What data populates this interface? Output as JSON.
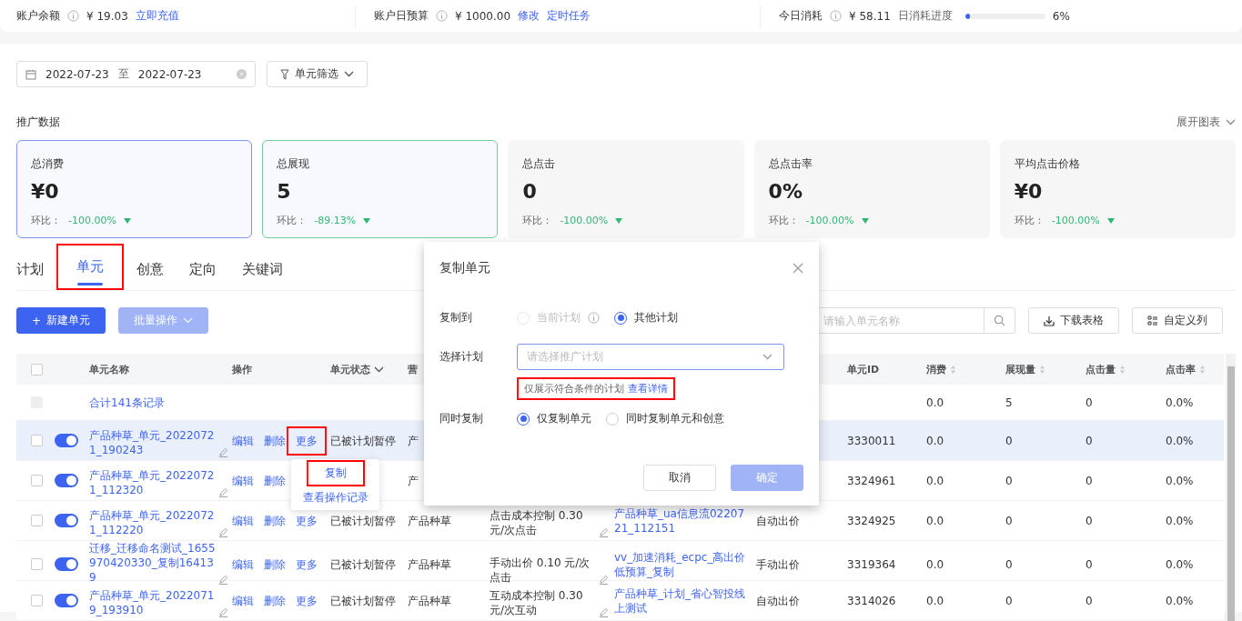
{
  "account_bar": {
    "items": [
      {
        "kind": "links",
        "label": "账户余额",
        "value": "¥ 19.03",
        "links": [
          "立即充值"
        ]
      },
      {
        "kind": "links",
        "label": "账户日预算",
        "value": "¥ 1000.00",
        "links": [
          "修改",
          "定时任务"
        ]
      },
      {
        "kind": "progress",
        "label": "今日消耗",
        "value": "¥ 58.11",
        "progress_label": "日消耗进度",
        "level": 0.06,
        "reading": "6%"
      }
    ]
  },
  "filters": {
    "date_from": "2022-07-23",
    "separator": "至",
    "date_to": "2022-07-23",
    "unit_filter": "单元筛选"
  },
  "stats": {
    "title": "推广数据",
    "expand": "展开图表",
    "cards": [
      {
        "label": "总消费",
        "value": "¥0",
        "change_label": "环比：",
        "change": "-100.00%",
        "selected": true,
        "color": "#7f95f3"
      },
      {
        "label": "总展现",
        "value": "5",
        "change_label": "环比：",
        "change": "-89.13%",
        "selected": true,
        "color": "#6fcf9f"
      },
      {
        "label": "总点击",
        "value": "0",
        "change_label": "环比：",
        "change": "-100.00%",
        "selected": false
      },
      {
        "label": "总点击率",
        "value": "0%",
        "change_label": "环比：",
        "change": "-100.00%",
        "selected": false
      },
      {
        "label": "平均点击价格",
        "value": "¥0",
        "change_label": "环比：",
        "change": "-100.00%",
        "selected": false
      }
    ]
  },
  "tabs": [
    {
      "label": "计划",
      "selected": false,
      "annotated": false
    },
    {
      "label": "单元",
      "selected": true,
      "annotated": true
    },
    {
      "label": "创意",
      "selected": false,
      "annotated": false
    },
    {
      "label": "定向",
      "selected": false,
      "annotated": false
    },
    {
      "label": "关键词",
      "selected": false,
      "annotated": false
    }
  ],
  "toolbar": {
    "new_icon": "+",
    "new_button": "新建单元",
    "batch_button": "批量操作",
    "batch_disabled": true,
    "search_placeholder": "请输入单元名称",
    "download_button": "下载表格",
    "columns_button": "自定义列"
  },
  "table": {
    "select_all_checked": false,
    "columns": [
      {
        "label": "单元名称",
        "sortable": false,
        "filter": false
      },
      {
        "label": "操作",
        "sortable": false,
        "filter": false
      },
      {
        "label": "单元状态",
        "sortable": false,
        "filter": true
      },
      {
        "label": "营",
        "sortable": false,
        "filter": false
      },
      {
        "label": "单元ID",
        "sortable": false,
        "filter": false
      },
      {
        "label": "消费",
        "sortable": true,
        "filter": false
      },
      {
        "label": "展现量",
        "sortable": true,
        "filter": false
      },
      {
        "label": "点击量",
        "sortable": true,
        "filter": false
      },
      {
        "label": "点击率",
        "sortable": true,
        "filter": false
      }
    ],
    "total": {
      "checkbox_disabled": true,
      "label": "合计141条记录",
      "cost": "0.0",
      "impressions": "5",
      "clicks": "0",
      "ctr": "0.0%"
    },
    "rows": [
      {
        "checked": false,
        "enabled": true,
        "hovered": true,
        "name": "产品种草_单元_20220721_190243",
        "actions": [
          {
            "label": "编辑",
            "annotated": false
          },
          {
            "label": "删除",
            "annotated": false
          },
          {
            "label": "更多",
            "annotated": true
          }
        ],
        "status": "已被计划暂停",
        "marketing": "产",
        "id": "3330011",
        "cost": "0.0",
        "impressions": "0",
        "clicks": "0",
        "ctr": "0.0%"
      },
      {
        "checked": false,
        "enabled": true,
        "hovered": false,
        "name": "产品种草_单元_20220721_112320",
        "actions": [
          {
            "label": "编辑",
            "annotated": false
          },
          {
            "label": "删除",
            "annotated": false
          }
        ],
        "marketing": "产",
        "id": "3324961",
        "cost": "0.0",
        "impressions": "0",
        "clicks": "0",
        "ctr": "0.0%"
      },
      {
        "checked": false,
        "enabled": true,
        "hovered": false,
        "name": "产品种草_单元_20220721_112220",
        "actions": [
          {
            "label": "编辑",
            "annotated": false
          },
          {
            "label": "删除",
            "annotated": false
          },
          {
            "label": "更多",
            "annotated": false
          }
        ],
        "status": "已被计划暂停",
        "marketing": "产品种草",
        "bid": "点击成本控制 0.30 元/次点击",
        "plan": "产品种草_ua信息流0220721_112151",
        "method": "自动出价",
        "id": "3324925",
        "cost": "0.0",
        "impressions": "0",
        "clicks": "0",
        "ctr": "0.0%"
      },
      {
        "checked": false,
        "enabled": true,
        "hovered": false,
        "name": "迁移_迁移命名测试_1655970420330_复制164139",
        "actions": [
          {
            "label": "编辑",
            "annotated": false
          },
          {
            "label": "删除",
            "annotated": false
          },
          {
            "label": "更多",
            "annotated": false
          }
        ],
        "status": "已被计划暂停",
        "marketing": "产品种草",
        "bid": "手动出价 0.10 元/次点击",
        "plan": "vv_加速消耗_ecpc_高出价低预算_复制",
        "method": "手动出价",
        "id": "3319364",
        "cost": "0.0",
        "impressions": "0",
        "clicks": "0",
        "ctr": "0.0%"
      },
      {
        "checked": false,
        "enabled": true,
        "hovered": false,
        "name": "产品种草_单元_20220719_193910",
        "actions": [
          {
            "label": "编辑",
            "annotated": false
          },
          {
            "label": "删除",
            "annotated": false
          },
          {
            "label": "更多",
            "annotated": false
          }
        ],
        "status": "已被计划暂停",
        "marketing": "产品种草",
        "bid": "互动成本控制 0.30 元/次互动",
        "plan": "产品种草_计划_省心智投线上测试",
        "method": "自动出价",
        "id": "3314026",
        "cost": "0.0",
        "impressions": "0",
        "clicks": "0",
        "ctr": "0.0%"
      }
    ]
  },
  "more_menu": {
    "items": [
      {
        "label": "复制",
        "annotated": true
      },
      {
        "label": "查看操作记录",
        "annotated": false
      }
    ]
  },
  "dialog": {
    "title": "复制单元",
    "copy_to": {
      "label": "复制到",
      "options": [
        {
          "label": "当前计划",
          "selected": false,
          "disabled": true,
          "info": true
        },
        {
          "label": "其他计划",
          "selected": true,
          "disabled": false,
          "info": false
        }
      ]
    },
    "plan": {
      "label": "选择计划",
      "placeholder": "请选择推广计划",
      "focused": true
    },
    "hint": {
      "text": "仅展示符合条件的计划",
      "link": "查看详情",
      "annotated": true
    },
    "copy_with": {
      "label": "同时复制",
      "options": [
        {
          "label": "仅复制单元",
          "selected": true,
          "disabled": false,
          "info": false
        },
        {
          "label": "同时复制单元和创意",
          "selected": false,
          "disabled": false,
          "info": false
        }
      ]
    },
    "buttons": [
      {
        "label": "取消",
        "kind": "default",
        "disabled": false
      },
      {
        "label": "确定",
        "kind": "primary",
        "disabled": true
      }
    ]
  }
}
